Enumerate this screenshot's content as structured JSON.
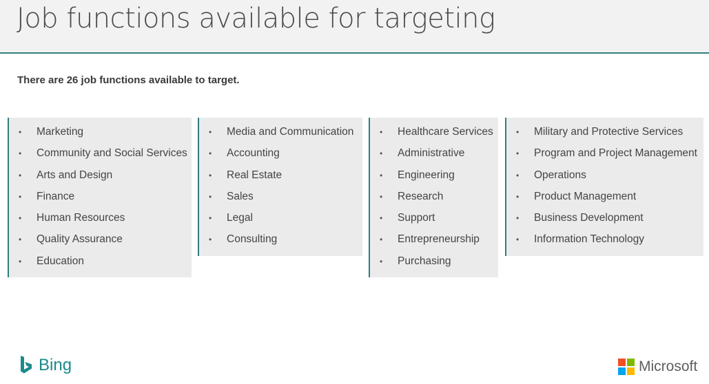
{
  "header": {
    "title": "Job functions available for targeting"
  },
  "subtitle": "There are 26 job functions available to target.",
  "columns": [
    {
      "items": [
        "Marketing",
        "Community and Social Services",
        "Arts and Design",
        "Finance",
        "Human Resources",
        "Quality Assurance",
        "Education"
      ]
    },
    {
      "items": [
        "Media and Communication",
        "Accounting",
        "Real Estate",
        "Sales",
        "Legal",
        "Consulting"
      ]
    },
    {
      "items": [
        "Healthcare Services",
        "Administrative",
        "Engineering",
        "Research",
        "Support",
        "Entrepreneurship",
        "Purchasing"
      ]
    },
    {
      "items": [
        "Military and Protective Services",
        "Program and Project Management",
        "Operations",
        "Product Management",
        "Business Development",
        "Information Technology"
      ]
    }
  ],
  "bullet": "•",
  "footer": {
    "bing_label": "Bing",
    "bing_icon": "bing-logo-icon",
    "microsoft_label": "Microsoft",
    "microsoft_icon": "microsoft-logo-icon"
  },
  "colors": {
    "accent": "#2e7d7d",
    "bing": "#1a8a8a",
    "ms_red": "#f25022",
    "ms_green": "#7fba00",
    "ms_blue": "#00a4ef",
    "ms_yellow": "#ffb900"
  }
}
